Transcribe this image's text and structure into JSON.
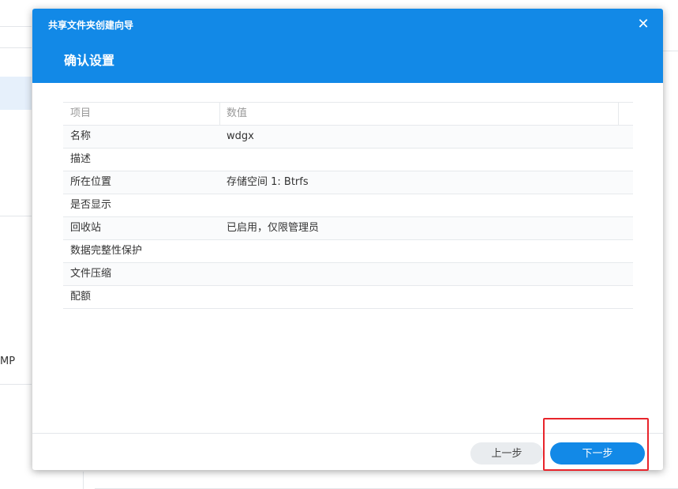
{
  "background": {
    "side_text": "MP"
  },
  "dialog": {
    "wizard_title": "共享文件夹创建向导",
    "close_glyph": "✕",
    "step_title": "确认设置",
    "table": {
      "headers": [
        "项目",
        "数值"
      ],
      "rows": [
        {
          "item": "名称",
          "value": "wdgx"
        },
        {
          "item": "描述",
          "value": ""
        },
        {
          "item": "所在位置",
          "value": "存储空间 1:  Btrfs"
        },
        {
          "item": "是否显示",
          "value": ""
        },
        {
          "item": "回收站",
          "value": "已启用，仅限管理员"
        },
        {
          "item": "数据完整性保护",
          "value": ""
        },
        {
          "item": "文件压缩",
          "value": ""
        },
        {
          "item": "配额",
          "value": ""
        }
      ]
    },
    "buttons": {
      "prev": "上一步",
      "next": "下一步"
    }
  },
  "colors": {
    "header": "#1289e7",
    "highlight": "#e8242b"
  }
}
